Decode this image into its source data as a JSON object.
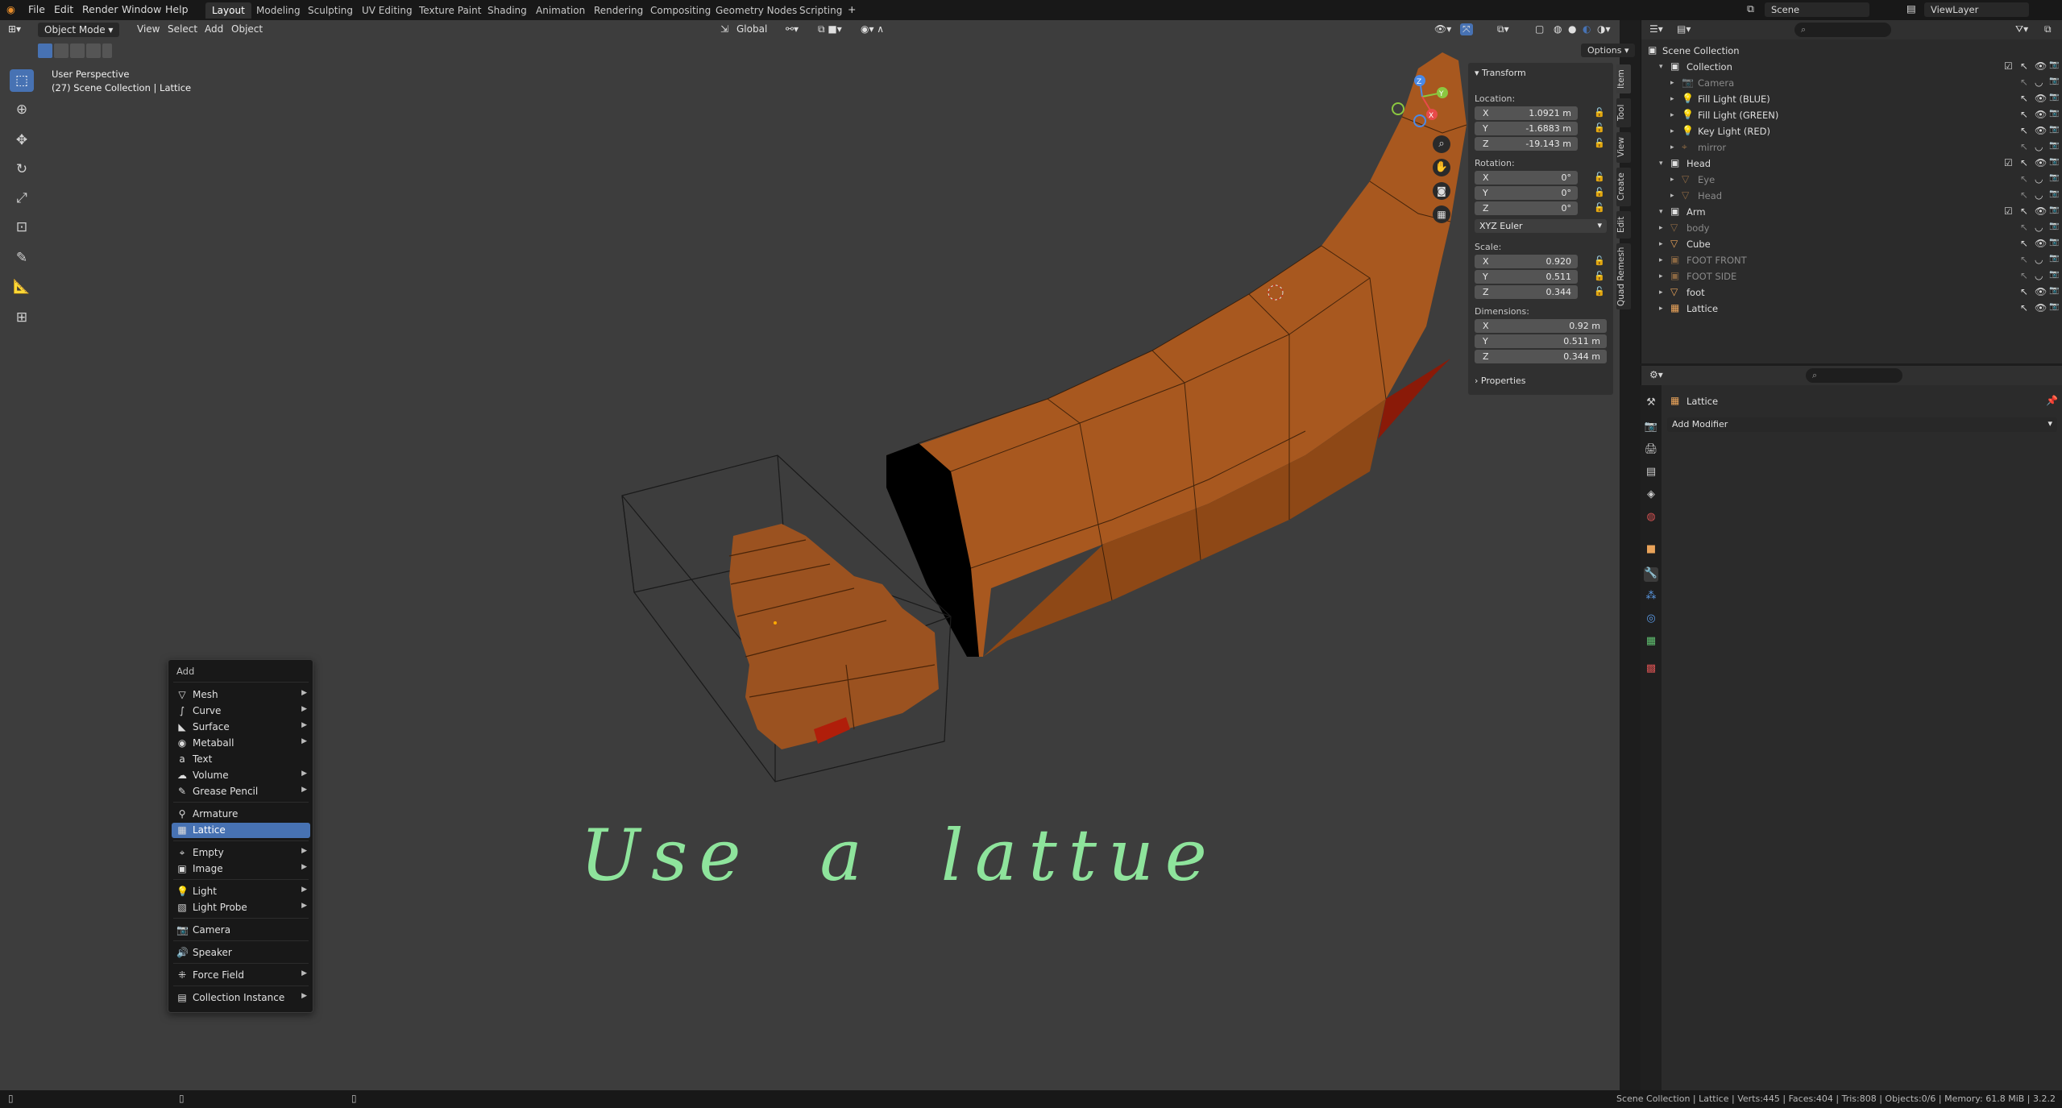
{
  "topbar": {
    "menus": [
      "File",
      "Edit",
      "Render",
      "Window",
      "Help"
    ],
    "workspaces": [
      "Layout",
      "Modeling",
      "Sculpting",
      "UV Editing",
      "Texture Paint",
      "Shading",
      "Animation",
      "Rendering",
      "Compositing",
      "Geometry Nodes",
      "Scripting"
    ],
    "active_workspace": "Layout",
    "scene": "Scene",
    "view_layer": "ViewLayer"
  },
  "viewport_header": {
    "mode": "Object Mode",
    "menus": [
      "View",
      "Select",
      "Add",
      "Object"
    ],
    "orientation": "Global",
    "options": "Options"
  },
  "viewport": {
    "view_name": "User Perspective",
    "collection_info": "(27) Scene Collection | Lattice",
    "annotation": "Use  a  lattue",
    "gizmo_labels": {
      "x": "X",
      "y": "Y",
      "z": "Z"
    }
  },
  "npanel": {
    "section_transform": "Transform",
    "location_label": "Location:",
    "location": [
      {
        "axis": "X",
        "value": "1.0921 m"
      },
      {
        "axis": "Y",
        "value": "-1.6883 m"
      },
      {
        "axis": "Z",
        "value": "-19.143 m"
      }
    ],
    "rotation_label": "Rotation:",
    "rotation": [
      {
        "axis": "X",
        "value": "0°"
      },
      {
        "axis": "Y",
        "value": "0°"
      },
      {
        "axis": "Z",
        "value": "0°"
      }
    ],
    "rotation_mode": "XYZ Euler",
    "scale_label": "Scale:",
    "scale": [
      {
        "axis": "X",
        "value": "0.920"
      },
      {
        "axis": "Y",
        "value": "0.511"
      },
      {
        "axis": "Z",
        "value": "0.344"
      }
    ],
    "dimensions_label": "Dimensions:",
    "dimensions": [
      {
        "axis": "X",
        "value": "0.92 m"
      },
      {
        "axis": "Y",
        "value": "0.511 m"
      },
      {
        "axis": "Z",
        "value": "0.344 m"
      }
    ],
    "section_properties": "Properties",
    "side_tabs": [
      "Item",
      "Tool",
      "View",
      "Create",
      "Edit",
      "Quad Remesh"
    ]
  },
  "outliner": {
    "root": "Scene Collection",
    "rows": [
      {
        "name": "Collection",
        "indent": 1,
        "icon": "collection-icon",
        "dim": false
      },
      {
        "name": "Camera",
        "indent": 2,
        "icon": "camera-icon",
        "dim": true
      },
      {
        "name": "Fill Light (BLUE)",
        "indent": 2,
        "icon": "light-icon",
        "dim": false
      },
      {
        "name": "Fill Light (GREEN)",
        "indent": 2,
        "icon": "light-icon",
        "dim": false
      },
      {
        "name": "Key Light (RED)",
        "indent": 2,
        "icon": "light-icon",
        "dim": false
      },
      {
        "name": "mirror",
        "indent": 2,
        "icon": "empty-icon",
        "dim": true
      },
      {
        "name": "Head",
        "indent": 1,
        "icon": "collection-icon",
        "dim": false
      },
      {
        "name": "Eye",
        "indent": 2,
        "icon": "mesh-icon",
        "dim": true
      },
      {
        "name": "Head",
        "indent": 2,
        "icon": "mesh-icon",
        "dim": true
      },
      {
        "name": "Arm",
        "indent": 1,
        "icon": "collection-icon",
        "dim": false
      },
      {
        "name": "body",
        "indent": 1,
        "icon": "mesh-icon",
        "dim": true
      },
      {
        "name": "Cube",
        "indent": 1,
        "icon": "mesh-icon",
        "dim": false
      },
      {
        "name": "FOOT FRONT",
        "indent": 1,
        "icon": "image-icon",
        "dim": true
      },
      {
        "name": "FOOT SIDE",
        "indent": 1,
        "icon": "image-icon",
        "dim": true
      },
      {
        "name": "foot",
        "indent": 1,
        "icon": "mesh-icon",
        "dim": false
      },
      {
        "name": "Lattice",
        "indent": 1,
        "icon": "lattice-icon",
        "dim": false
      }
    ]
  },
  "properties": {
    "object_name": "Lattice",
    "add_modifier": "Add Modifier"
  },
  "add_menu": {
    "title": "Add",
    "items": [
      {
        "label": "Mesh",
        "icon": "mesh-icon",
        "glyph": "▽",
        "submenu": true
      },
      {
        "label": "Curve",
        "icon": "curve-icon",
        "glyph": "∫",
        "submenu": true
      },
      {
        "label": "Surface",
        "icon": "surface-icon",
        "glyph": "◣",
        "submenu": true
      },
      {
        "label": "Metaball",
        "icon": "metaball-icon",
        "glyph": "◉",
        "submenu": true
      },
      {
        "label": "Text",
        "icon": "text-icon",
        "glyph": "a",
        "submenu": false
      },
      {
        "label": "Volume",
        "icon": "volume-icon",
        "glyph": "☁",
        "submenu": true
      },
      {
        "label": "Grease Pencil",
        "icon": "grease-pencil-icon",
        "glyph": "✎",
        "submenu": true
      },
      {
        "label": "Armature",
        "icon": "armature-icon",
        "glyph": "⚲",
        "submenu": false
      },
      {
        "label": "Lattice",
        "icon": "lattice-icon",
        "glyph": "▦",
        "submenu": false,
        "selected": true
      },
      {
        "label": "Empty",
        "icon": "empty-icon",
        "glyph": "⌖",
        "submenu": true
      },
      {
        "label": "Image",
        "icon": "image-icon",
        "glyph": "▣",
        "submenu": true
      },
      {
        "label": "Light",
        "icon": "light-icon",
        "glyph": "💡",
        "submenu": true
      },
      {
        "label": "Light Probe",
        "icon": "light-probe-icon",
        "glyph": "▧",
        "submenu": true
      },
      {
        "label": "Camera",
        "icon": "camera-icon",
        "glyph": "📷",
        "submenu": false
      },
      {
        "label": "Speaker",
        "icon": "speaker-icon",
        "glyph": "🔊",
        "submenu": false
      },
      {
        "label": "Force Field",
        "icon": "force-field-icon",
        "glyph": "⁜",
        "submenu": true
      },
      {
        "label": "Collection Instance",
        "icon": "collection-instance-icon",
        "glyph": "▤",
        "submenu": true
      }
    ]
  },
  "statusbar": {
    "stats": "Scene Collection | Lattice | Verts:445 | Faces:404 | Tris:808 | Objects:0/6 | Memory: 61.8 MiB | 3.2.2"
  },
  "colors": {
    "accent": "#4772b3",
    "viewport_bg": "#3d3d3d",
    "mesh_orange": "#a85a22",
    "annotation_green": "#8ee49c"
  }
}
